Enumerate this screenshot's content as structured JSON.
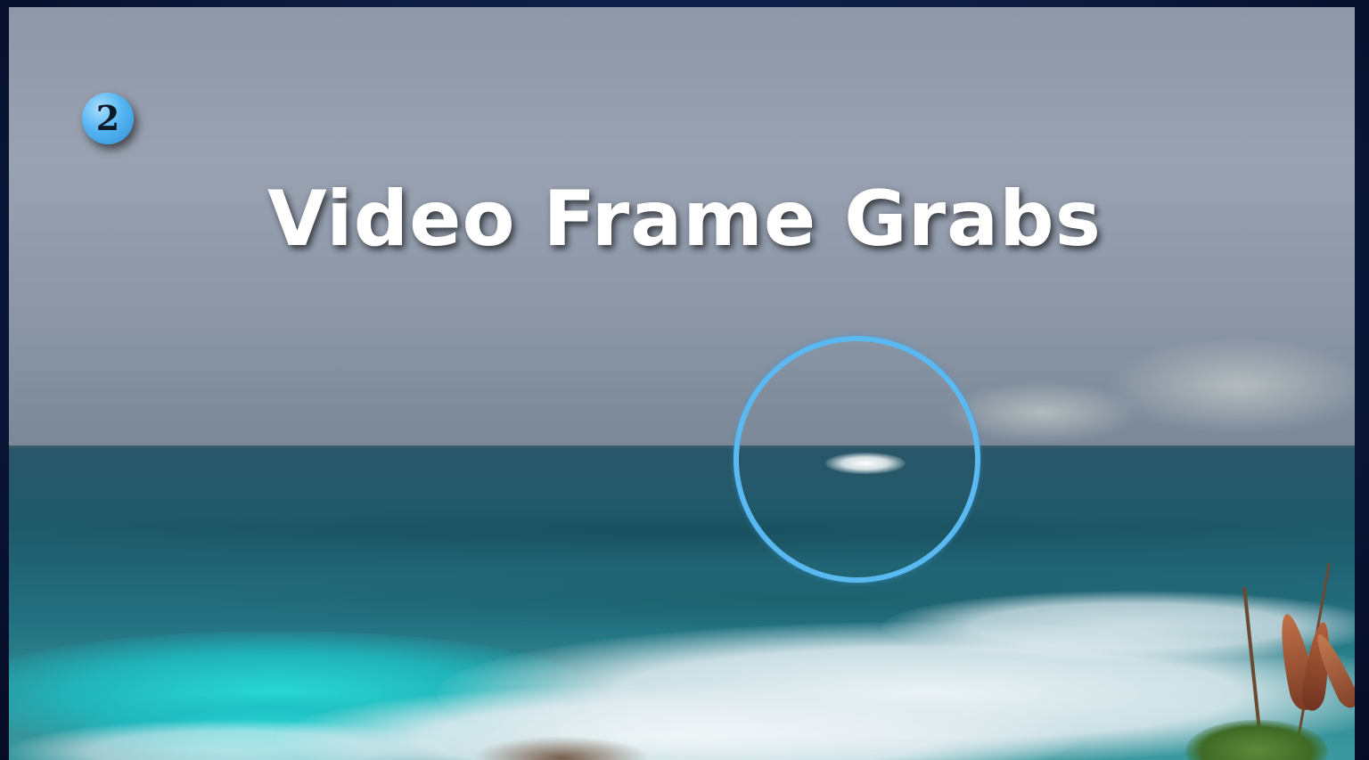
{
  "slide": {
    "step_number": "2",
    "title": "Video Frame Grabs"
  },
  "colors": {
    "background": "#0c1a3e",
    "title_text": "#ffffff",
    "accent_ring": "#5ab9f0",
    "badge_fill": "#56b6f2"
  },
  "icons": {
    "step_badge": "numbered-circle-icon",
    "highlight": "circle-highlight-icon"
  }
}
